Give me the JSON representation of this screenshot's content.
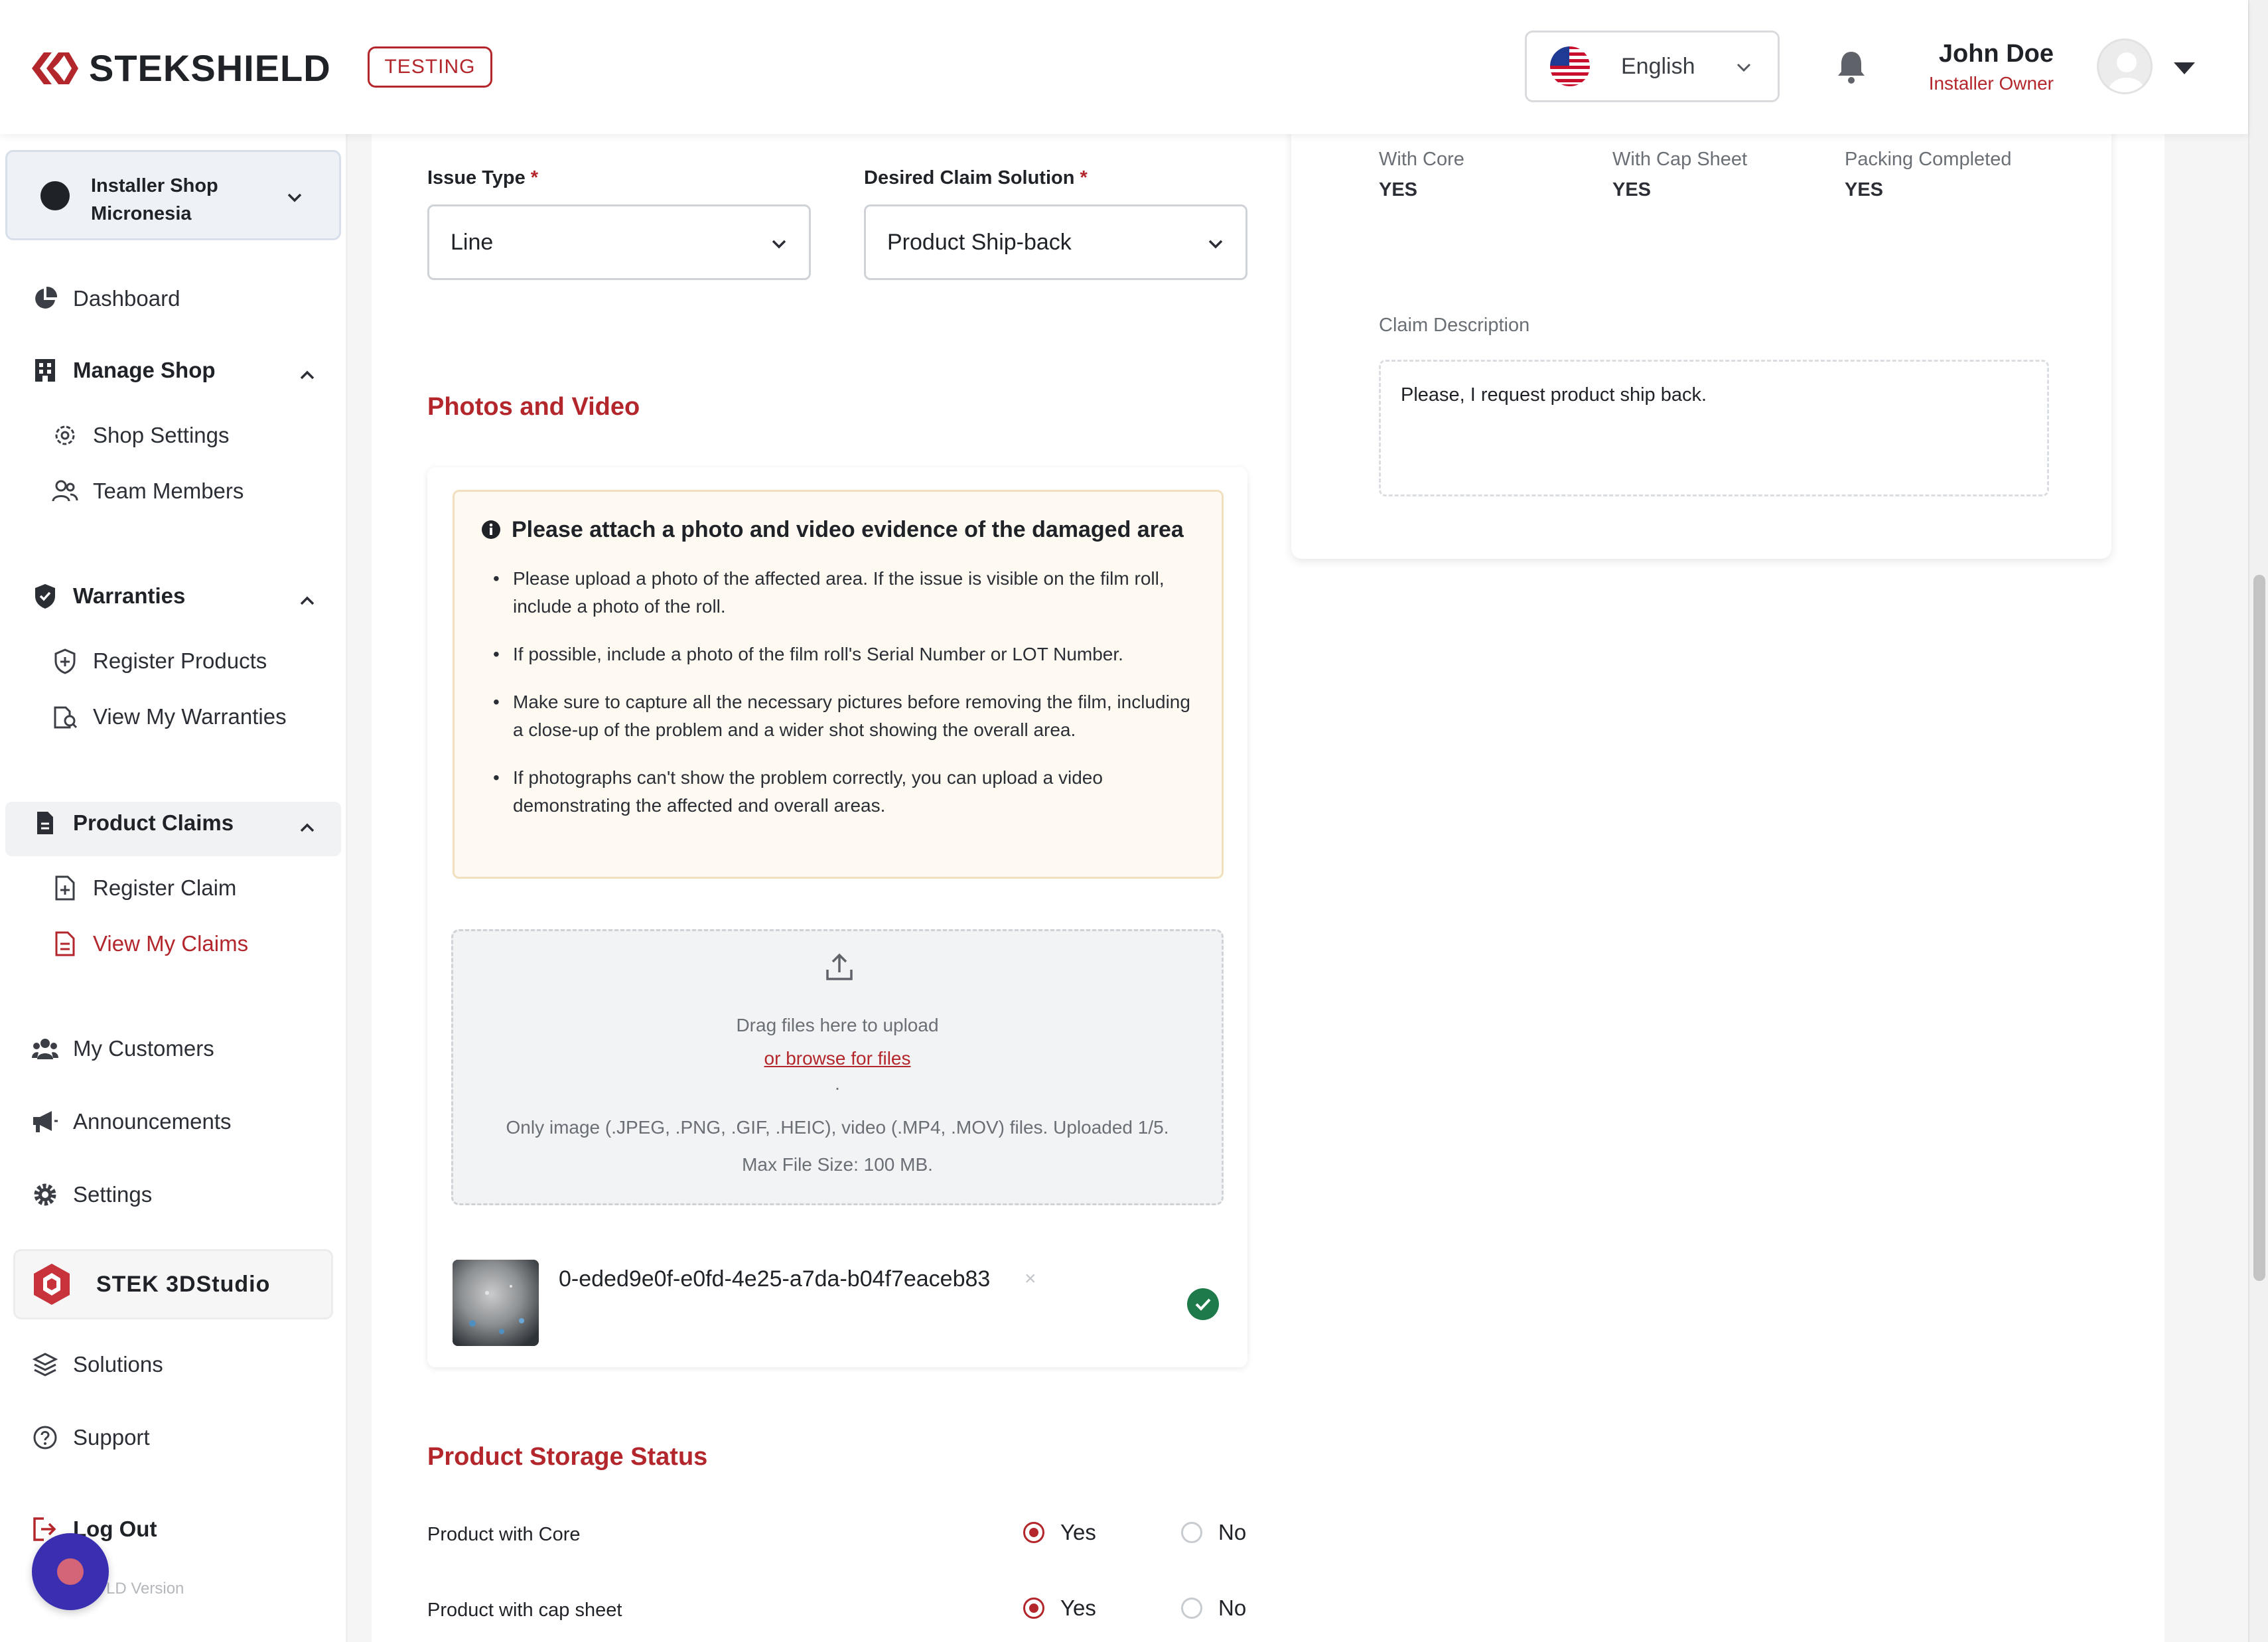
{
  "header": {
    "brand": "STEKSHIELD",
    "env_badge": "TESTING",
    "language": "English",
    "user_name": "John Doe",
    "user_role": "Installer Owner"
  },
  "sidebar": {
    "shop_line1": "Installer Shop",
    "shop_line2": "Micronesia",
    "dashboard": "Dashboard",
    "manage_shop": "Manage Shop",
    "shop_settings": "Shop Settings",
    "team_members": "Team Members",
    "warranties": "Warranties",
    "register_products": "Register Products",
    "view_warranties": "View My Warranties",
    "product_claims": "Product Claims",
    "register_claim": "Register Claim",
    "view_claims": "View My Claims",
    "my_customers": "My Customers",
    "announcements": "Announcements",
    "settings": "Settings",
    "stek3d": "STEK 3DStudio",
    "solutions": "Solutions",
    "support": "Support",
    "logout": "Log Out",
    "version": "LD Version"
  },
  "form": {
    "issue_type_label": "Issue Type",
    "issue_type_value": "Line",
    "claim_solution_label": "Desired Claim Solution",
    "claim_solution_value": "Product Ship-back",
    "required_mark": "*"
  },
  "photos": {
    "section_title": "Photos and Video",
    "info_title": "Please attach a photo and video evidence of the damaged area",
    "tips": [
      "Please upload a photo of the affected area. If the issue is visible on the film roll, include a photo of the roll.",
      "If possible, include a photo of the film roll's Serial Number or LOT Number.",
      "Make sure to capture all the necessary pictures before removing the film, including a close-up of the problem and a wider shot showing the overall area.",
      "If photographs can't show the problem correctly, you can upload a video demonstrating the affected and overall areas."
    ],
    "drag_text": "Drag files here to upload",
    "browse_link": "or browse for files",
    "dot": ".",
    "types_text": "Only image (.JPEG, .PNG, .GIF, .HEIC), video (.MP4, .MOV) files. Uploaded 1/5.",
    "max_size": "Max File Size: 100 MB.",
    "file_name": "0-eded9e0f-e0fd-4e25-a7da-b04f7eaceb83",
    "remove_glyph": "×"
  },
  "storage": {
    "section_title": "Product Storage Status",
    "rows": [
      {
        "label": "Product with Core",
        "selected": "Yes"
      },
      {
        "label": "Product with cap sheet",
        "selected": "Yes"
      }
    ],
    "yes": "Yes",
    "no": "No"
  },
  "summary": {
    "with_core_label": "With Core",
    "with_core_value": "YES",
    "cap_sheet_label": "With Cap Sheet",
    "cap_sheet_value": "YES",
    "packing_label": "Packing Completed",
    "packing_value": "YES",
    "description_label": "Claim Description",
    "description_value": "Please, I request product ship back."
  },
  "colors": {
    "brand_red": "#b3262c",
    "success_green": "#1e7a4a",
    "chat_purple": "#3a2fb0"
  }
}
